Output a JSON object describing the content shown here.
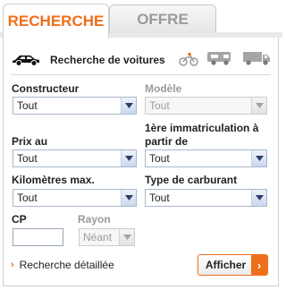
{
  "tabs": [
    {
      "label": "RECHERCHE",
      "active": true
    },
    {
      "label": "OFFRE",
      "active": false
    }
  ],
  "vehicle_types": {
    "title": "Recherche de voitures",
    "icons": [
      "car-icon",
      "motorcycle-icon",
      "camper-icon",
      "truck-icon"
    ]
  },
  "form": {
    "constructeur": {
      "label": "Constructeur",
      "value": "Tout"
    },
    "modele": {
      "label": "Modèle",
      "value": "Tout",
      "disabled": true
    },
    "prix": {
      "label": "Prix au",
      "value": "Tout"
    },
    "immatriculation": {
      "label_line1": "1ère immatriculation à",
      "label_line2": "partir de",
      "value": "Tout"
    },
    "kilometres": {
      "label": "Kilomètres max.",
      "value": "Tout"
    },
    "carburant": {
      "label": "Type de carburant",
      "value": "Tout"
    },
    "cp": {
      "label": "CP",
      "value": ""
    },
    "rayon": {
      "label": "Rayon",
      "value": "Néant",
      "disabled": true
    }
  },
  "actions": {
    "detail_link": "Recherche détaillée",
    "submit": "Afficher"
  },
  "colors": {
    "accent": "#ee6f1b",
    "inactive_text": "#9a9a9a",
    "select_border": "#a9b7c9"
  }
}
